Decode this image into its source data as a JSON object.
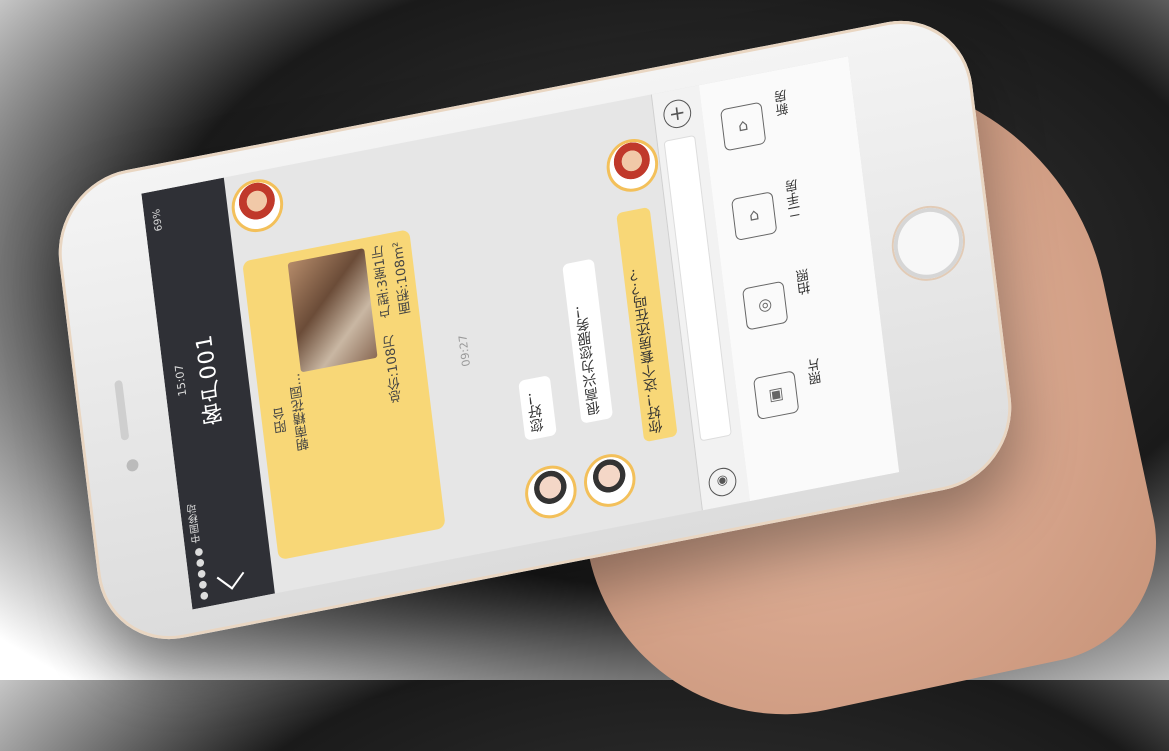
{
  "status": {
    "carrier": "●●●●● 中国移动",
    "time": "15:07",
    "battery": "69%"
  },
  "header": {
    "title": "客户001",
    "back_icon": "chevron-left-icon"
  },
  "property_card": {
    "title": "朝南精花园...",
    "subtitle": "阳台",
    "price": "总价:108万",
    "layout": "户型:3室1厅",
    "area": "面积:108m²"
  },
  "timestamp": "09:27",
  "messages": [
    {
      "from": "agent",
      "text": "您好！"
    },
    {
      "from": "agent",
      "text": "很高兴为您服务！"
    },
    {
      "from": "customer",
      "text": "你好！这个套房还在吗？？"
    }
  ],
  "input": {
    "plus_icon": "plus-icon",
    "voice_icon": "voice-icon",
    "value": ""
  },
  "tools": [
    {
      "icon": "new-house-icon",
      "label": "新房"
    },
    {
      "icon": "second-hand-house-icon",
      "label": "二手房"
    },
    {
      "icon": "camera-icon",
      "label": "拍照"
    },
    {
      "icon": "photo-icon",
      "label": "照片"
    }
  ],
  "colors": {
    "accent": "#f8d777",
    "header": "#2f3036"
  }
}
